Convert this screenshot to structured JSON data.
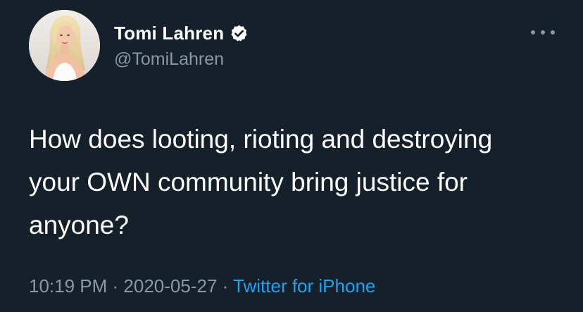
{
  "tweet": {
    "author": {
      "display_name": "Tomi Lahren",
      "handle": "@TomiLahren",
      "verified": true,
      "avatar_icon": "profile-photo"
    },
    "text": "How does looting, rioting and destroying\nyour OWN community bring justice for\nanyone?",
    "time": "10:19 PM",
    "separator_1": " · ",
    "date": "2020-05-27",
    "separator_2": " · ",
    "source": "Twitter for iPhone",
    "menu_icon": "more-horizontal-icon"
  },
  "colors": {
    "background": "#15202b",
    "text": "#ffffff",
    "secondary_text": "#8899a6",
    "link": "#1da1f2"
  }
}
